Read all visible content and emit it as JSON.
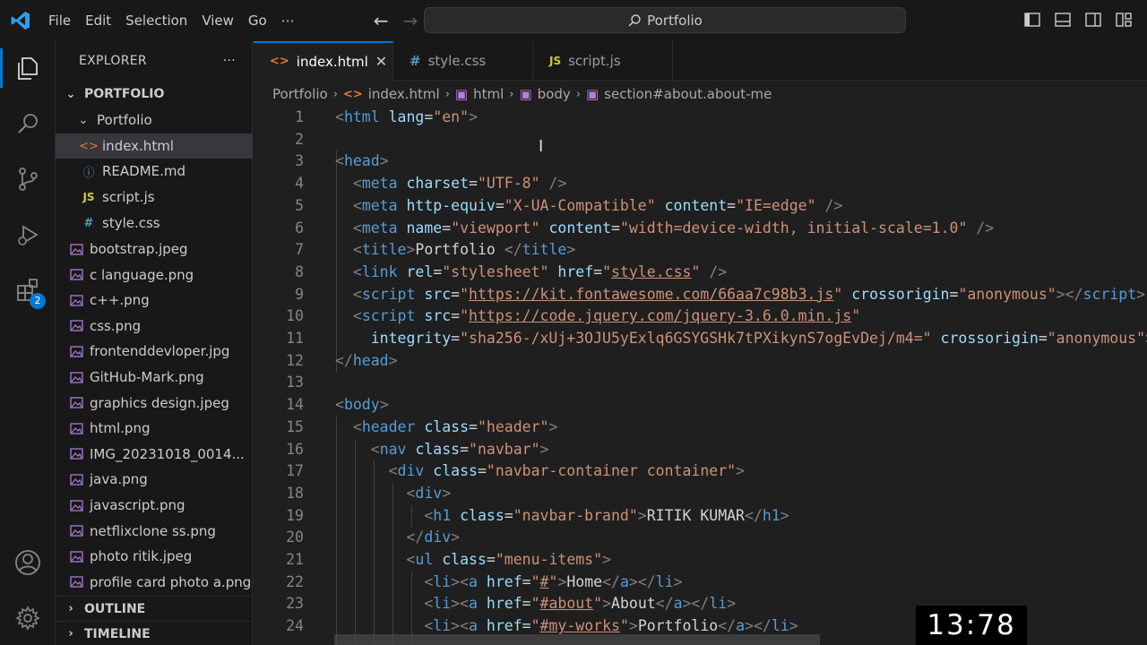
{
  "menu": [
    "File",
    "Edit",
    "Selection",
    "View",
    "Go",
    "⋯"
  ],
  "command_center": {
    "label": "Portfolio"
  },
  "sidebar": {
    "title": "EXPLORER",
    "more": "···",
    "root": "PORTFOLIO",
    "folder": "Portfolio",
    "files": [
      {
        "name": "index.html",
        "icon": "<>"
      },
      {
        "name": "README.md",
        "icon": "ⓘ"
      },
      {
        "name": "script.js",
        "icon": "JS"
      },
      {
        "name": "style.css",
        "icon": "#"
      }
    ],
    "images": [
      "bootstrap.jpeg",
      "c language.png",
      "c++.png",
      "css.png",
      "frontenddevloper.jpg",
      "GitHub-Mark.png",
      "graphics design.jpeg",
      "html.png",
      "IMG_20231018_0014...",
      "java.png",
      "javascript.png",
      "netflixclone ss.png",
      "photo ritik.jpeg",
      "profile card photo a.png"
    ],
    "outline": "OUTLINE",
    "timeline": "TIMELINE"
  },
  "activity": {
    "badge": "2"
  },
  "tabs": [
    {
      "label": "index.html",
      "icon": "<>"
    },
    {
      "label": "style.css",
      "icon": "#"
    },
    {
      "label": "script.js",
      "icon": "JS"
    }
  ],
  "breadcrumb": [
    "Portfolio",
    "index.html",
    "html",
    "body",
    "section#about.about-me"
  ],
  "timer": "13:78"
}
